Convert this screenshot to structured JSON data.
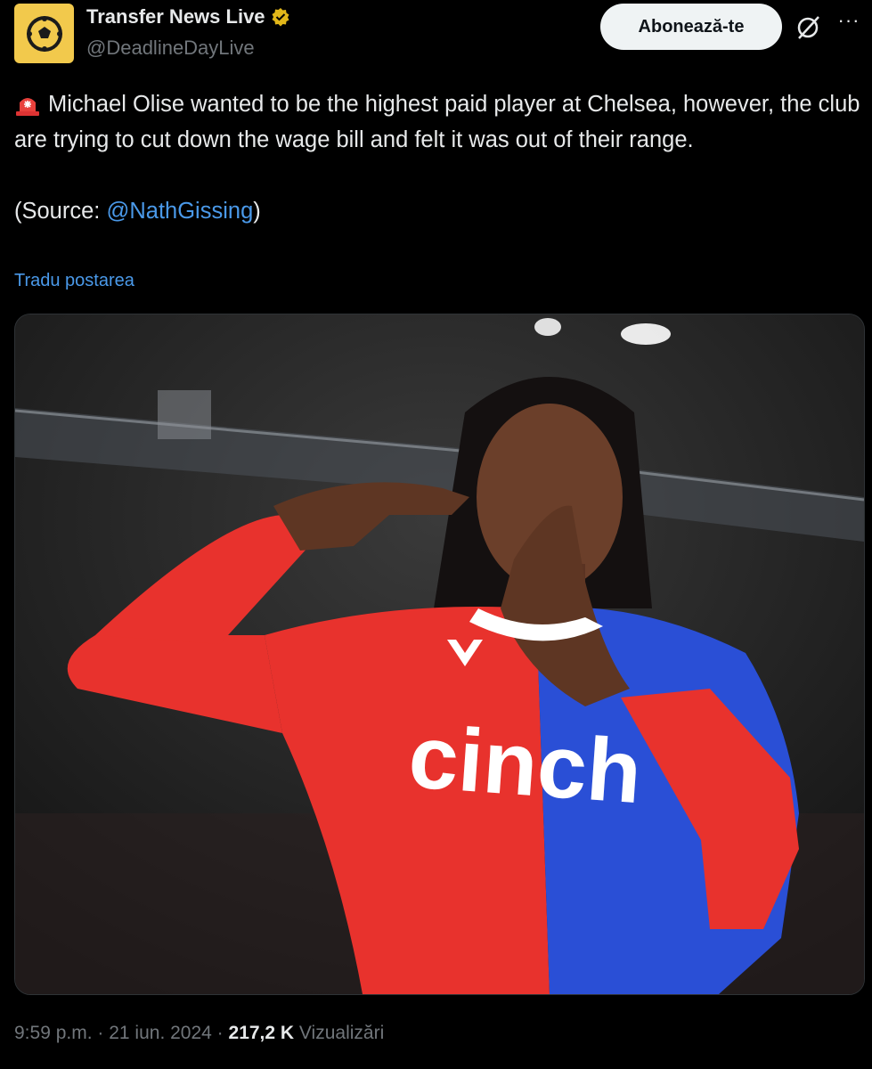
{
  "author": {
    "name": "Transfer News Live",
    "handle": "@DeadlineDayLive",
    "avatar_icon": "football-icon",
    "verified_icon": "verified-badge-icon",
    "avatar_color": "#f2c94c"
  },
  "actions": {
    "subscribe_label": "Abonează-te",
    "grok_icon": "grok-icon",
    "more_icon": "more-options-icon"
  },
  "post": {
    "siren_icon": "siren-icon",
    "line1": "Michael Olise wanted to be the highest paid player at Chelsea, however, the club are trying to cut down the wage bill and felt it was out of their range.",
    "source_prefix": "(Source: ",
    "source_mention": "@NathGissing",
    "source_suffix": ")",
    "translate_label": "Tradu postarea"
  },
  "media": {
    "type": "image",
    "shirt_sponsor": "cinch",
    "colors": {
      "red": "#e8322d",
      "blue": "#2a4fd6"
    }
  },
  "footer": {
    "time": "9:59 p.m.",
    "sep1": " · ",
    "date": "21 iun. 2024",
    "sep2": " · ",
    "views_count": "217,2 K",
    "views_label": "Vizualizări"
  },
  "colors": {
    "background": "#000000",
    "text": "#e7e9ea",
    "muted": "#71767b",
    "link": "#4a99e9"
  }
}
